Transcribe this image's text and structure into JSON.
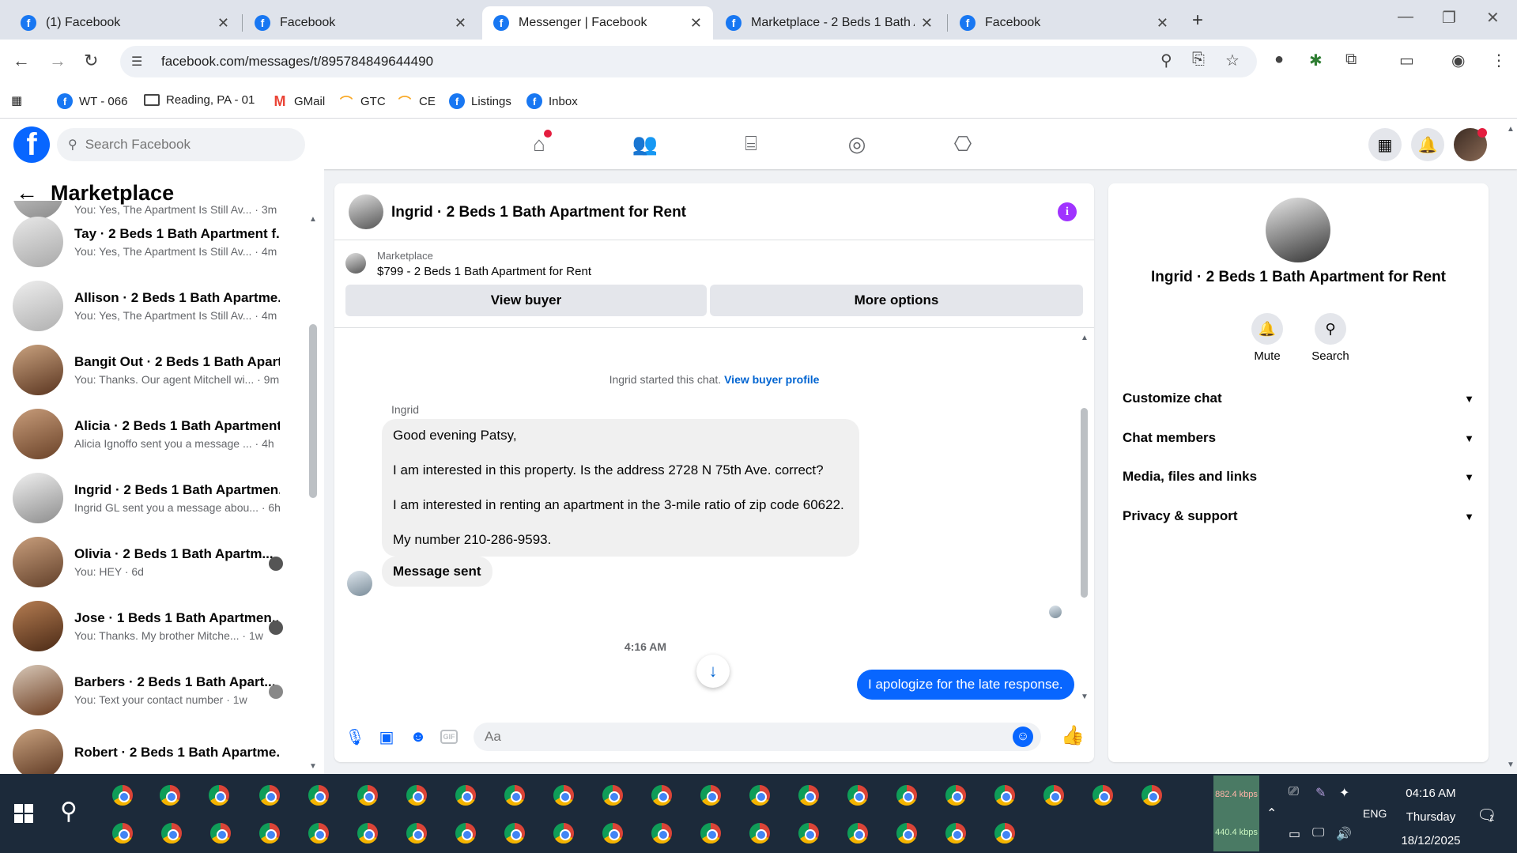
{
  "browser": {
    "tabs": [
      {
        "title": "(1) Facebook"
      },
      {
        "title": "Facebook"
      },
      {
        "title": "Messenger | Facebook"
      },
      {
        "title": "Marketplace - 2 Beds 1 Bath Ap"
      },
      {
        "title": "Facebook"
      }
    ],
    "active_tab": 2,
    "url": "facebook.com/messages/t/895784849644490",
    "bookmarks": [
      {
        "label": "WT - 066",
        "icon": "facebook-icon"
      },
      {
        "label": "Reading, PA - 01",
        "icon": "folder-icon"
      },
      {
        "label": "GMail",
        "icon": "gmail-icon"
      },
      {
        "label": "GTC",
        "icon": "rainbow-icon"
      },
      {
        "label": "CE",
        "icon": "rainbow-icon"
      },
      {
        "label": "Listings",
        "icon": "facebook-icon"
      },
      {
        "label": "Inbox",
        "icon": "facebook-icon"
      }
    ]
  },
  "facebook": {
    "search_placeholder": "Search Facebook",
    "brand_color": "#0866ff"
  },
  "sidebar": {
    "title": "Marketplace",
    "partial_top_preview": "You: Yes, The Apartment Is Still Av... · 3m",
    "conversations": [
      {
        "name": "Tay · 2 Beds 1 Bath Apartment f...",
        "preview": "You: Yes, The Apartment Is Still Av... · 4m"
      },
      {
        "name": "Allison · 2 Beds 1 Bath Apartme...",
        "preview": "You: Yes, The Apartment Is Still Av... · 4m"
      },
      {
        "name": "Bangit Out · 2 Beds 1 Bath Apart...",
        "preview": "You: Thanks. Our agent Mitchell wi... · 9m"
      },
      {
        "name": "Alicia · 2 Beds 1 Bath Apartment...",
        "preview": "Alicia Ignoffo sent you a message ... · 4h"
      },
      {
        "name": "Ingrid · 2 Beds 1 Bath Apartmen...",
        "preview": "Ingrid GL sent you a message abou... · 6h"
      },
      {
        "name": "Olivia · 2 Beds 1 Bath Apartm...",
        "preview": "You: HEY · 6d"
      },
      {
        "name": "Jose · 1 Beds 1 Bath Apartmen...",
        "preview": "You: Thanks. My brother Mitche... · 1w"
      },
      {
        "name": "Barbers · 2 Beds 1 Bath Apart...",
        "preview": "You: Text your contact number · 1w"
      },
      {
        "name": "Robert · 2 Beds 1 Bath Apartme...",
        "preview": ""
      }
    ]
  },
  "chat": {
    "title": "Ingrid · 2 Beds 1 Bath Apartment for Rent",
    "listing_source": "Marketplace",
    "listing_name": "$799 - 2 Beds 1 Bath Apartment for Rent",
    "view_buyer_label": "View buyer",
    "more_options_label": "More options",
    "system_text": "Ingrid started this chat.",
    "system_link": "View buyer profile",
    "sender_name": "Ingrid",
    "message_lines": [
      "Good evening Patsy,",
      "I am interested in this property. Is the address 2728 N 75th Ave. correct?",
      "I am interested in renting an apartment in the 3-mile ratio of zip code 60622.",
      "My number 210-286-9593."
    ],
    "message_sent": "Message sent",
    "timestamp": "4:16 AM",
    "outgoing_message": "I apologize for the late response.",
    "composer_placeholder": "Aa",
    "accent_color": "#0866ff"
  },
  "details": {
    "name": "Ingrid · 2 Beds 1 Bath Apartment for Rent",
    "mute_label": "Mute",
    "search_label": "Search",
    "sections": [
      "Customize chat",
      "Chat members",
      "Media, files and links",
      "Privacy & support"
    ]
  },
  "taskbar": {
    "net_up": "882.4 kbps",
    "net_down": "440.4 kbps",
    "language": "ENG",
    "time": "04:16 AM",
    "day": "Thursday",
    "date": "18/12/2025",
    "notification_count": "1"
  }
}
